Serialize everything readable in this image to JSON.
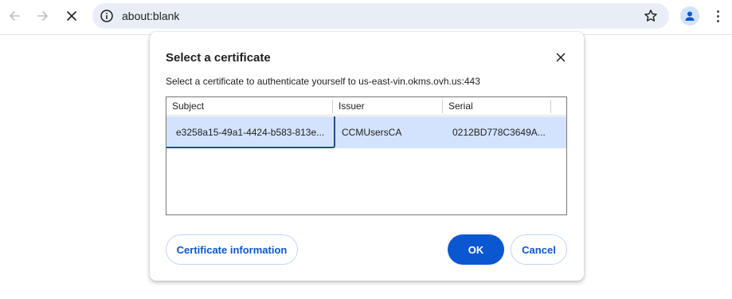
{
  "browser": {
    "url": "about:blank",
    "back_icon": "arrow-back-icon",
    "forward_icon": "arrow-forward-icon",
    "stop_icon": "close-icon",
    "info_icon": "info-icon",
    "bookmark_icon": "star-icon",
    "profile_icon": "person-icon",
    "menu_icon": "more-vert-icon"
  },
  "dialog": {
    "title": "Select a certificate",
    "description": "Select a certificate to authenticate yourself to us-east-vin.okms.ovh.us:443",
    "close_icon": "close-icon",
    "table": {
      "columns": [
        "Subject",
        "Issuer",
        "Serial"
      ],
      "rows": [
        {
          "subject": "e3258a15-49a1-4424-b583-813e...",
          "issuer": "CCMUsersCA",
          "serial": "0212BD778C3649A...",
          "selected": true
        }
      ]
    },
    "buttons": {
      "info": "Certificate information",
      "ok": "OK",
      "cancel": "Cancel"
    }
  },
  "colors": {
    "accent": "#0b57d0",
    "selected_row": "#d3e3fd",
    "omnibox_bg": "#e9eef6"
  }
}
